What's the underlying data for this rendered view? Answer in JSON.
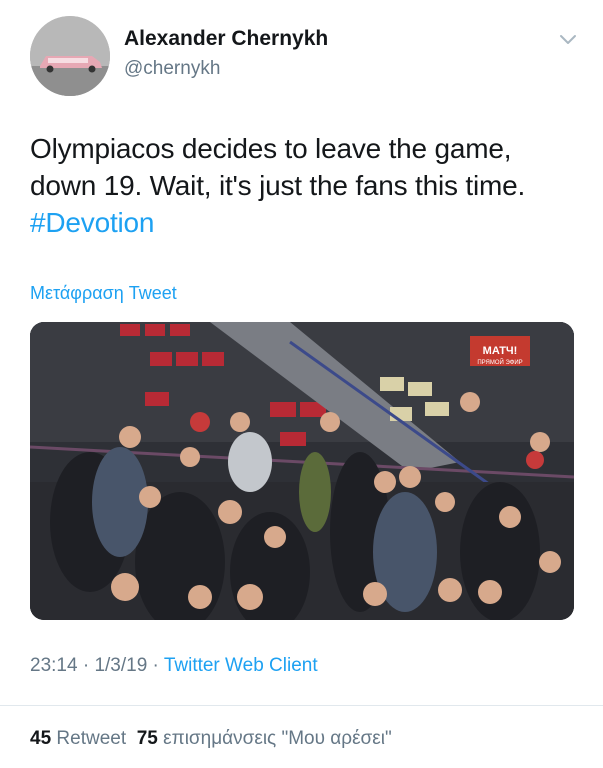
{
  "user": {
    "display_name": "Alexander Chernykh",
    "handle": "@chernykh"
  },
  "tweet": {
    "text_line1": "Olympiacos decides to leave the game,",
    "text_line2": "down 19. Wait, it's just the fans this time.",
    "hashtag": "#Devotion",
    "translate_label": "Μετάφραση Tweet"
  },
  "media": {
    "overlay_logo": "МАТЧ!",
    "overlay_sub": "ПРЯМОЙ ЭФИР"
  },
  "meta": {
    "time": "23:14",
    "separator": "·",
    "date": "1/3/19",
    "client": "Twitter Web Client"
  },
  "stats": {
    "retweets_count": "45",
    "retweets_label": "Retweet",
    "likes_count": "75",
    "likes_label": "επισημάνσεις \"Μου αρέσει\""
  },
  "colors": {
    "link": "#1da1f2",
    "secondary_text": "#657786",
    "primary_text": "#14171a"
  },
  "icons": [
    "chevron-down-icon"
  ]
}
